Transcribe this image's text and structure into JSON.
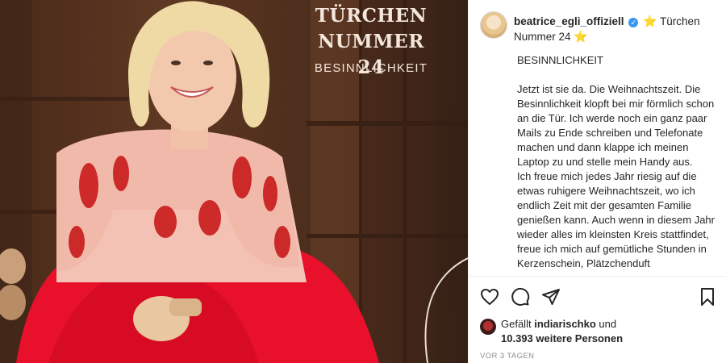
{
  "photo": {
    "title_line1": "TÜRCHEN",
    "title_line2": "NUMMER 24",
    "subtitle": "BESINNLICHKEIT"
  },
  "post": {
    "username": "beatrice_egli_offiziell",
    "verified_icon": "verified-badge-icon",
    "header_text": "Türchen Nummer 24",
    "star_emoji": "⭐",
    "caption_heading": "BESINNLICHKEIT",
    "caption_p1": "Jetzt ist sie da. Die Weihnachtszeit. Die Besinnlichkeit klopft bei mir förmlich schon an die Tür. Ich werde noch ein ganz paar Mails zu Ende schreiben und Telefonate machen und dann klappe ich meinen Laptop zu und stelle mein Handy aus.",
    "caption_p2": "Ich freue mich jedes Jahr riesig auf die etwas ruhigere Weihnachtszeit, wo ich endlich Zeit mit der gesamten Familie genießen kann. Auch wenn in diesem Jahr wieder alles im kleinsten Kreis stattfindet, freue ich mich auf gemütliche Stunden in Kerzenschein, Plätzchenduft"
  },
  "actions": {
    "like_icon": "heart-icon",
    "comment_icon": "comment-icon",
    "share_icon": "share-icon",
    "save_icon": "bookmark-icon"
  },
  "likes": {
    "prefix": "Gefällt",
    "user": "indiarischko",
    "joiner": "und",
    "others": "10.393 weitere Personen"
  },
  "timestamp": "VOR 3 TAGEN",
  "colors": {
    "dress_red": "#e8102a",
    "wood_brown": "#5e3822",
    "verified_blue": "#3897f0",
    "star_yellow": "#f5b400"
  }
}
